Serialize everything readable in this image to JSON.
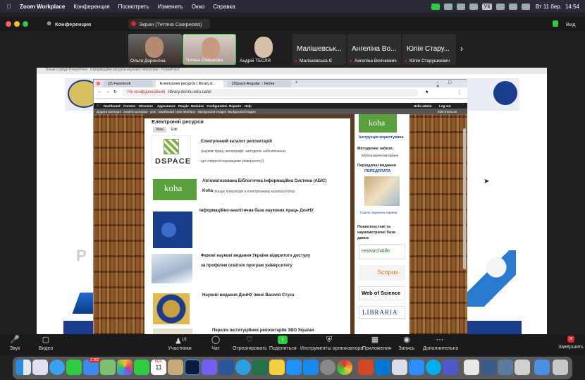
{
  "menubar": {
    "app": "Zoom Workplace",
    "items": [
      "Конференция",
      "Посмотреть",
      "Изменить",
      "Окно",
      "Справка"
    ],
    "keyboard": "УК",
    "clock": "Вт 11 бер.",
    "time": "14:54"
  },
  "zoom": {
    "title": "Конференция",
    "share_label": "Экран (Тетяна Смирнова)",
    "view_label": "Вид"
  },
  "gallery": {
    "tiles": [
      {
        "name": "Ольга Доронгіна"
      },
      {
        "name": "Тетяна Смирнова"
      },
      {
        "name": "Андрій ТЕСЛЯ"
      },
      {
        "big": "Малішевськ...",
        "name": "Малішевська Є"
      },
      {
        "big": "Ангеліна Во...",
        "name": "Ангеліна Волчкевич"
      },
      {
        "big": "Юлія Стару...",
        "name": "Юлія Старушкевич"
      }
    ]
  },
  "ppt": {
    "title": "Тільки слайди PowerPoint - інформаційні ресурси наукової бібліотеки - PowerPoint"
  },
  "browser": {
    "tabs": [
      "(2) Facebook",
      "Електронні ресурси | library.d...",
      "DSpace Angular :: Home"
    ],
    "security": "Не конфіденційний",
    "url": "library.donnu.edu.ua/er",
    "drupal_menu": [
      "Dashboard",
      "Content",
      "Structure",
      "Appearance",
      "People",
      "Modules",
      "Configuration",
      "Reports",
      "Help"
    ],
    "drupal_user": "Hello admin",
    "drupal_logout": "Log out",
    "shortcuts": [
      "Додати матеріал",
      "Знайти матеріал",
      "yeni",
      "Dashboard",
      "User interface",
      "Background Images",
      "Background images"
    ],
    "edit_shortcuts": "Edit shortcuts"
  },
  "page": {
    "title": "Електронні ресурси",
    "tab_view": "View",
    "tab_edit": "Edit",
    "resources": [
      {
        "logo": "DSPACE",
        "title": "Електронний каталог  репозитарій",
        "desc1": "(наукові праці, монографії, методичні забезпечення,",
        "desc2": "що створені науковцями університету)"
      },
      {
        "logo": "koha",
        "title": "Автоматизована Бібліотечна Інформаційна Система (АБІС)",
        "desc1": "Koha",
        "desc2": "(пошук літератури в електронному каталозі Koha)"
      },
      {
        "title": "Інформаційно-аналітична база наукових праць ДонНУ"
      },
      {
        "title": "Фахові наукові видання України  відкритого доступу",
        "desc1": "за профілем освітніх програм університету"
      },
      {
        "title": "Наукові видання ДонНУ імені Василя Стуса"
      },
      {
        "title": "Перелік інституційних репозитаріїв ЗВО України"
      }
    ],
    "sidebar": {
      "koha": "koha",
      "instr": "Інструкція користувача",
      "method": "Методичне забезп.",
      "biblio": "Бібліографічні матеріали",
      "period": "Періодичні видання",
      "podpiska": "ПЕРЕДПЛАТА",
      "gazety": "Газети і журнали України",
      "fulltext": "Повнотекстові та наукометричні бази даних",
      "r4l": "research4life",
      "scopus": "Scopus",
      "wos": "Web of Science",
      "libraria": "LIBRARIA"
    }
  },
  "toolbar": {
    "items": [
      "Звук",
      "Видео",
      "Участники",
      "Чат",
      "Отреагировать",
      "Поделиться",
      "Инструменты организатора",
      "Приложения",
      "Запись",
      "Дополнительно",
      "Завершить"
    ],
    "participants_count": "18"
  },
  "dock": {
    "badge_mail": "2 352",
    "cal_month": "БЕР.",
    "cal_day": "11"
  },
  "colors": {
    "zoom_green": "#2ecc40",
    "end_red": "#e02424",
    "ppt_title_blue": "#1a3c8c"
  }
}
